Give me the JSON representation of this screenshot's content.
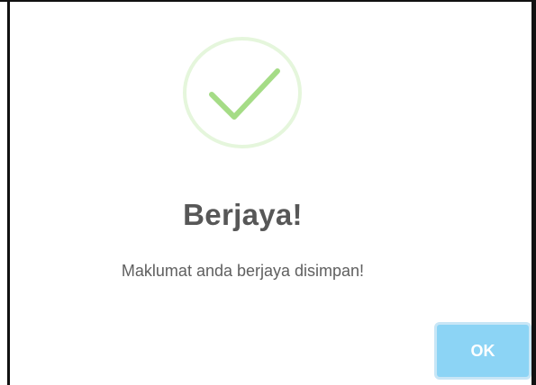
{
  "dialog": {
    "icon": "check-circle-icon",
    "title": "Berjaya!",
    "message": "Maklumat anda berjaya disimpan!",
    "confirm_label": "OK"
  },
  "colors": {
    "check": "#a5dc86",
    "ring": "#e5f6dc",
    "button": "#8cd4f5",
    "button_focus_ring": "#c8e6f6",
    "title_text": "#575757"
  }
}
